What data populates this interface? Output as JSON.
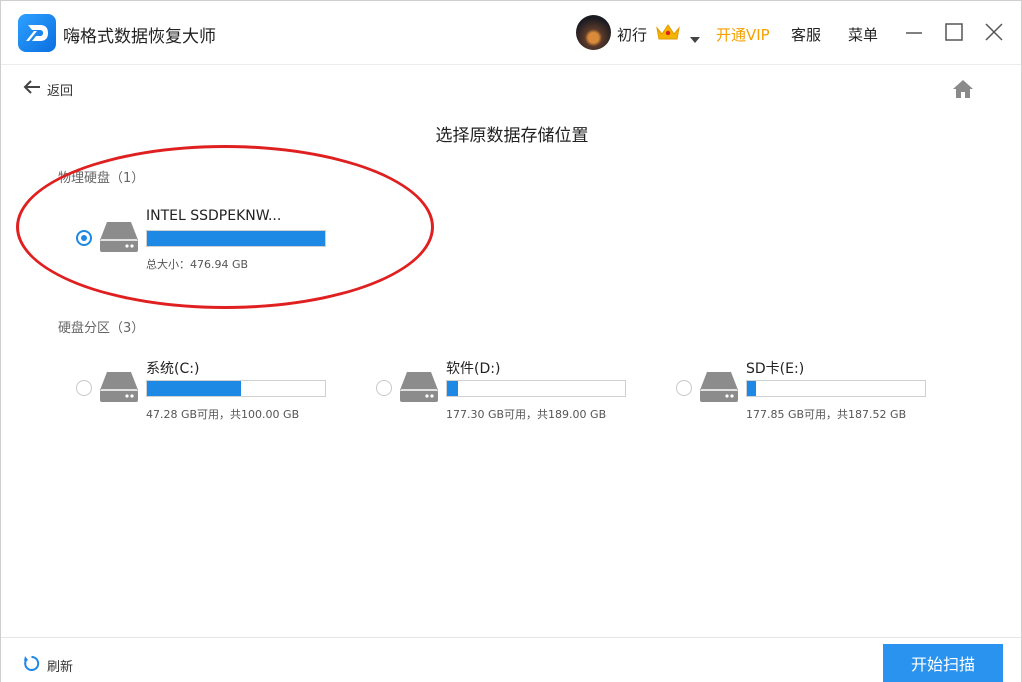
{
  "app": {
    "title": "嗨格式数据恢复大师",
    "user": "初行",
    "vip_label": "开通VIP",
    "service_label": "客服",
    "menu_label": "菜单"
  },
  "nav": {
    "back_label": "返回"
  },
  "page": {
    "title": "选择原数据存储位置"
  },
  "physical": {
    "label": "物理硬盘（1）",
    "drives": [
      {
        "name": "INTEL SSDPEKNW...",
        "info": "总大小：476.94 GB",
        "used_fraction": 1.0,
        "selected": true
      }
    ]
  },
  "partitions": {
    "label": "硬盘分区（3）",
    "drives": [
      {
        "name": "系统(C:)",
        "info": "47.28 GB可用，共100.00 GB",
        "used_fraction": 0.53,
        "selected": false
      },
      {
        "name": "软件(D:)",
        "info": "177.30 GB可用，共189.00 GB",
        "used_fraction": 0.06,
        "selected": false
      },
      {
        "name": "SD卡(E:)",
        "info": "177.85 GB可用，共187.52 GB",
        "used_fraction": 0.05,
        "selected": false
      }
    ]
  },
  "footer": {
    "refresh_label": "刷新",
    "scan_label": "开始扫描"
  },
  "colors": {
    "accent": "#1e88e5",
    "vip": "#f5a100",
    "annotation": "#e02020"
  }
}
